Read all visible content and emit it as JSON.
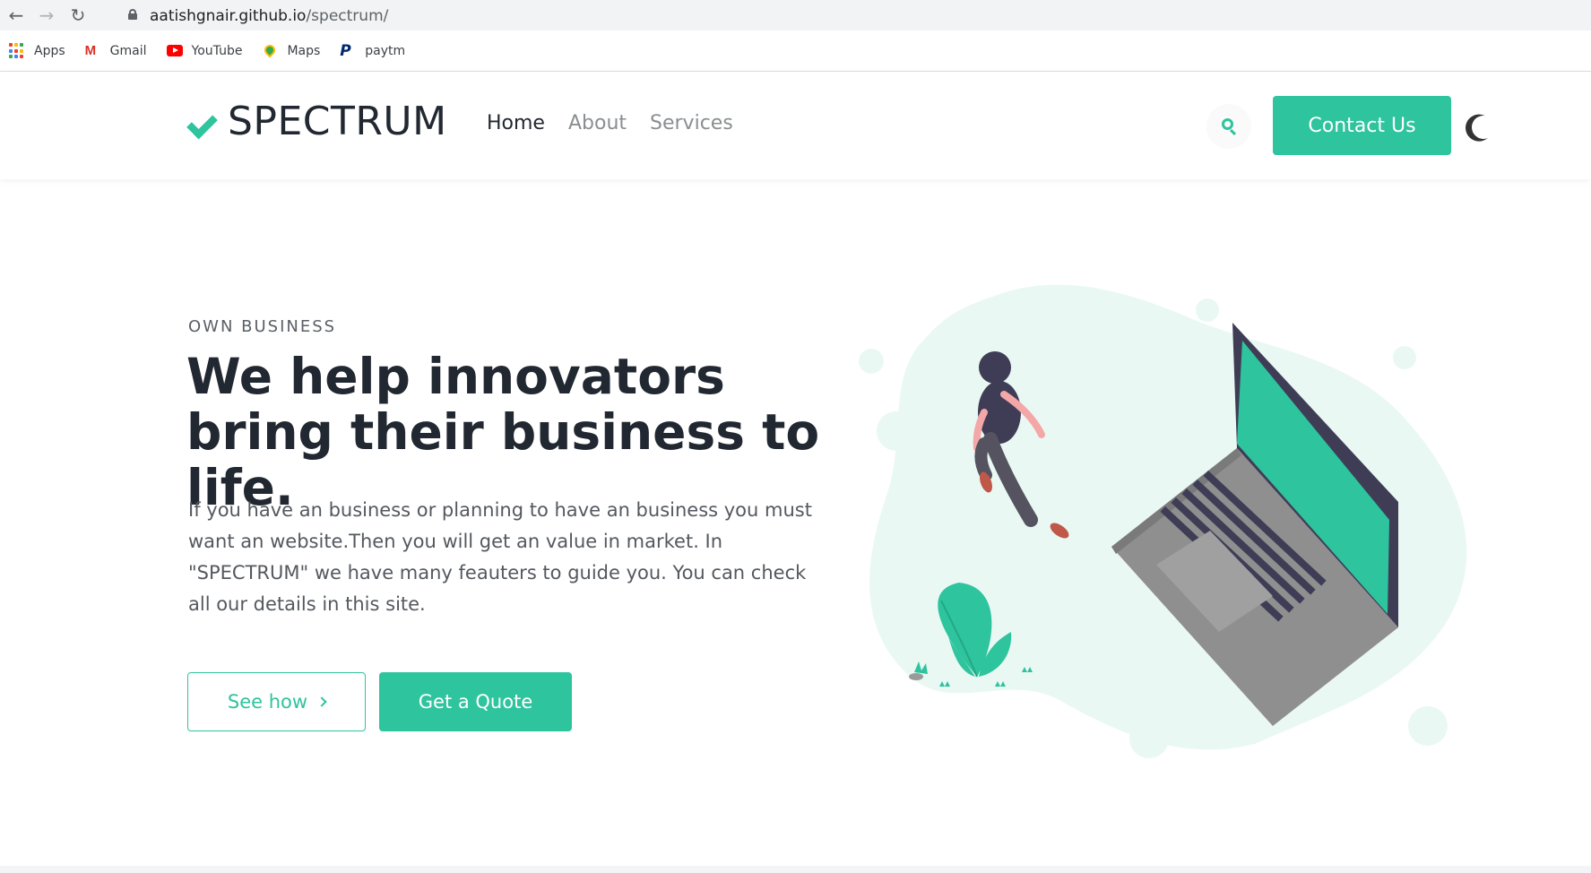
{
  "browser": {
    "url_host": "aatishgnair.github.io",
    "url_path": "/spectrum/",
    "bookmarks": [
      {
        "label": "Apps",
        "icon": "apps-grid-icon"
      },
      {
        "label": "Gmail",
        "icon": "gmail-icon"
      },
      {
        "label": "YouTube",
        "icon": "youtube-icon"
      },
      {
        "label": "Maps",
        "icon": "maps-icon"
      },
      {
        "label": "paytm",
        "icon": "paytm-icon"
      }
    ]
  },
  "header": {
    "logo_text": "SPECTRUM",
    "nav": [
      {
        "label": "Home",
        "active": true
      },
      {
        "label": "About",
        "active": false
      },
      {
        "label": "Services",
        "active": false
      }
    ],
    "contact_label": "Contact Us"
  },
  "hero": {
    "eyebrow": "OWN BUSINESS",
    "headline": "We help innovators bring their business to life.",
    "description": "If you have an business or planning to have an business you must want an website.Then you will get an value in market. In \"SPECTRUM\" we have many feauters to guide you. You can check all our details in this site.",
    "see_how_label": "See how",
    "quote_label": "Get a Quote"
  },
  "colors": {
    "accent": "#2ec49d",
    "heading": "#222831",
    "blob": "#eaf8f4"
  }
}
